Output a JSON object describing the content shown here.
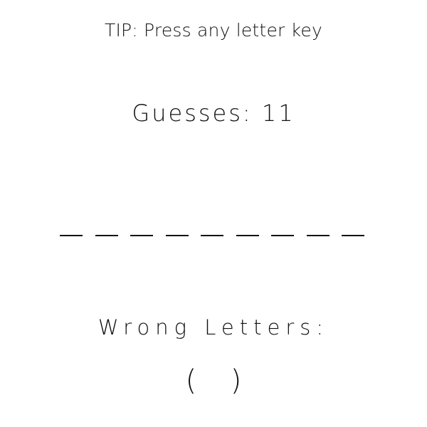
{
  "tip": "TIP: Press any letter key",
  "guesses": {
    "label": "Guesses:",
    "count": "11"
  },
  "word": {
    "length": 9,
    "letters": [
      "",
      "",
      "",
      "",
      "",
      "",
      "",
      "",
      ""
    ]
  },
  "wrong_letters": {
    "title": "Wrong Letters:",
    "open": "(",
    "close": ")",
    "list": ""
  }
}
